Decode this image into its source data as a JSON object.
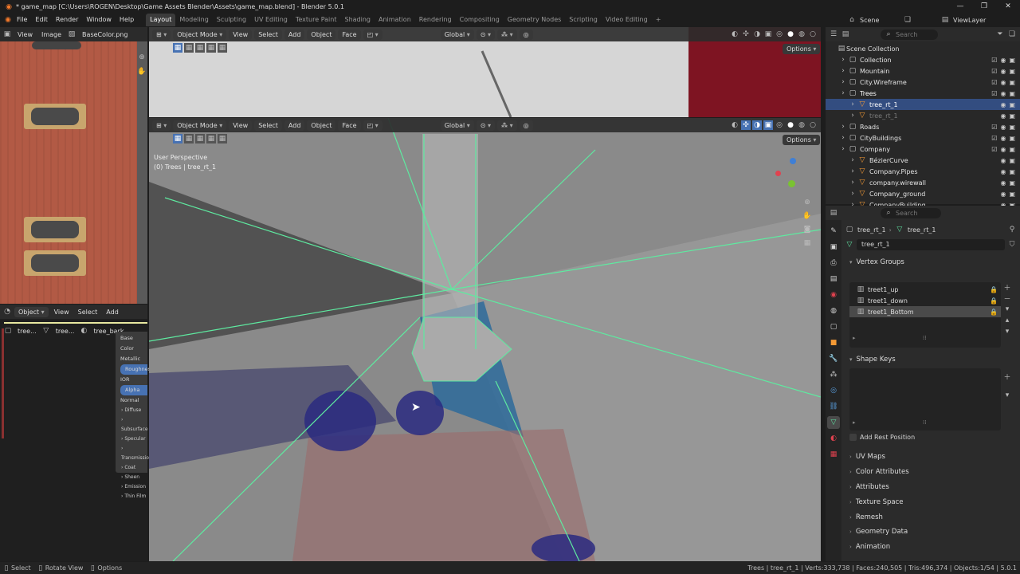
{
  "title": "* game_map [C:\\Users\\ROGEN\\Desktop\\Game Assets Blender\\Assets\\game_map.blend] - Blender 5.0.1",
  "menu": [
    "File",
    "Edit",
    "Render",
    "Window",
    "Help"
  ],
  "workspaces": [
    "Layout",
    "Modeling",
    "Sculpting",
    "UV Editing",
    "Texture Paint",
    "Shading",
    "Animation",
    "Rendering",
    "Compositing",
    "Geometry Nodes",
    "Scripting",
    "Video Editing"
  ],
  "active_workspace": "Layout",
  "scene": "Scene",
  "view_layer": "ViewLayer",
  "image_editor": {
    "view": "View",
    "image": "Image",
    "image_name": "BaseColor.png"
  },
  "node_editor": {
    "type": "Object",
    "view": "View",
    "select": "Select",
    "add": "Add",
    "crumbs": [
      "tree...",
      "tree...",
      "tree_bark"
    ],
    "sockets": [
      "Base Color",
      "Metallic",
      "Roughness",
      "IOR",
      "Alpha",
      "Normal"
    ],
    "subpanels": [
      "Diffuse",
      "Subsurface",
      "Specular",
      "Transmission",
      "Coat",
      "Sheen",
      "Emission",
      "Thin Film"
    ]
  },
  "viewport_top": {
    "mode": "Object Mode",
    "view": "View",
    "select": "Select",
    "add": "Add",
    "object": "Object",
    "face": "Face",
    "orientation": "Global",
    "options": "Options"
  },
  "viewport_main": {
    "mode": "Object Mode",
    "view": "View",
    "select": "Select",
    "add": "Add",
    "object": "Object",
    "face": "Face",
    "orientation": "Global",
    "options": "Options",
    "perspective": "User Perspective",
    "context": "(0) Trees | tree_rt_1"
  },
  "outliner": {
    "search_placeholder": "Search",
    "root": "Scene Collection",
    "items": [
      {
        "label": "Collection",
        "level": 1,
        "selected": false,
        "color": "#e3e3e3"
      },
      {
        "label": "Mountain",
        "level": 1,
        "selected": false,
        "color": "#e3e3e3"
      },
      {
        "label": "City.Wireframe",
        "level": 1,
        "selected": false,
        "color": "#e3e3e3"
      },
      {
        "label": "Trees",
        "level": 1,
        "selected": false,
        "color": "#ffffff"
      },
      {
        "label": "tree_rt_1",
        "level": 2,
        "selected": true,
        "color": "#ffffff"
      },
      {
        "label": "tree_rt_1",
        "level": 2,
        "selected": false,
        "color": "#7a7a7a"
      },
      {
        "label": "Roads",
        "level": 1,
        "selected": false,
        "color": "#e3e3e3"
      },
      {
        "label": "CityBuildings",
        "level": 1,
        "selected": false,
        "color": "#e3e3e3"
      },
      {
        "label": "Company",
        "level": 1,
        "selected": false,
        "color": "#e3e3e3"
      },
      {
        "label": "BézierCurve",
        "level": 2,
        "selected": false,
        "color": "#e3e3e3"
      },
      {
        "label": "Company.Pipes",
        "level": 2,
        "selected": false,
        "color": "#e3e3e3"
      },
      {
        "label": "company.wirewall",
        "level": 2,
        "selected": false,
        "color": "#e3e3e3"
      },
      {
        "label": "Company_ground",
        "level": 2,
        "selected": false,
        "color": "#e3e3e3"
      },
      {
        "label": "CompanyBuilding",
        "level": 2,
        "selected": false,
        "color": "#e3e3e3"
      }
    ]
  },
  "properties": {
    "search_placeholder": "Search",
    "breadcrumb_object": "tree_rt_1",
    "breadcrumb_mesh": "tree_rt_1",
    "mesh_name": "tree_rt_1",
    "vertex_groups_title": "Vertex Groups",
    "vertex_groups": [
      "treet1_up",
      "treet1_down",
      "treet1_Bottom"
    ],
    "selected_vertex_group": 2,
    "shape_keys_title": "Shape Keys",
    "add_rest_position": "Add Rest Position",
    "sections": [
      "UV Maps",
      "Color Attributes",
      "Attributes",
      "Texture Space",
      "Remesh",
      "Geometry Data",
      "Animation"
    ]
  },
  "status": {
    "left": [
      "Select",
      "Rotate View",
      "Options"
    ],
    "right": "Trees | tree_rt_1 | Verts:333,738 | Faces:240,505 | Tris:496,374 | Objects:1/54 | 5.0.1"
  }
}
